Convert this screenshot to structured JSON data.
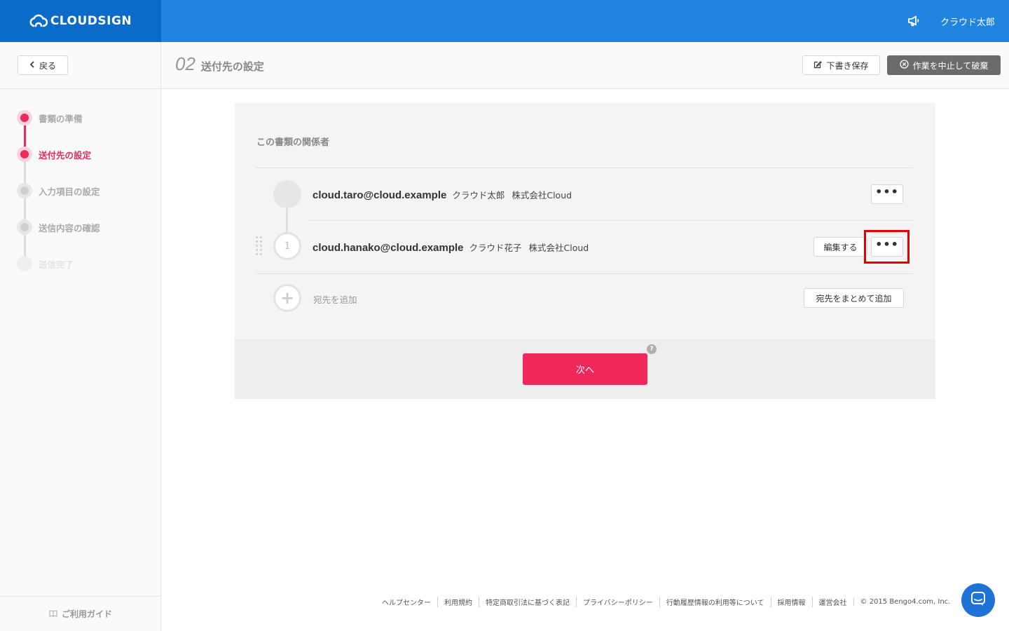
{
  "header": {
    "logo_text": "CLOUDSIGN",
    "user_name": "クラウド太郎",
    "announce_icon": "megaphone-icon"
  },
  "subheader": {
    "back_label": "戻る",
    "step_number": "02",
    "step_title": "送付先の設定",
    "draft_label": "下書き保存",
    "abort_label": "作業を中止して破棄"
  },
  "sidebar": {
    "steps": [
      {
        "label": "書類の準備",
        "state": "done"
      },
      {
        "label": "送付先の設定",
        "state": "current"
      },
      {
        "label": "入力項目の設定",
        "state": "todo"
      },
      {
        "label": "送信内容の確認",
        "state": "todo"
      },
      {
        "label": "送信完了",
        "state": "future"
      }
    ],
    "guide_label": "ご利用ガイド"
  },
  "main": {
    "section_title": "この書類の関係者",
    "sender": {
      "email": "cloud.taro@cloud.example",
      "name": "クラウド太郎",
      "company": "株式会社Cloud",
      "more_label": "•••"
    },
    "recipients": [
      {
        "order": "1",
        "email": "cloud.hanako@cloud.example",
        "name": "クラウド花子",
        "company": "株式会社Cloud",
        "edit_label": "編集する",
        "more_label": "•••"
      }
    ],
    "add_label": "宛先を追加",
    "bulk_add_label": "宛先をまとめて追加",
    "next_label": "次へ",
    "help_mark": "?"
  },
  "footer": {
    "links": [
      "ヘルプセンター",
      "利用規約",
      "特定商取引法に基づく表記",
      "プライバシーポリシー",
      "行動履歴情報の利用等について",
      "採用情報",
      "運営会社"
    ],
    "copyright": "© 2015 Bengo4.com, Inc."
  },
  "colors": {
    "brand_blue": "#2184e0",
    "brand_dark_blue": "#0b6bc9",
    "accent_pink": "#f0275a",
    "highlight_red": "#e30000"
  }
}
